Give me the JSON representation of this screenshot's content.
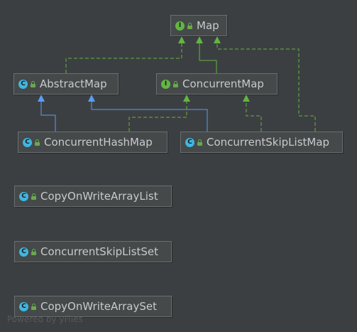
{
  "nodes": {
    "map": {
      "label": "Map",
      "kind": "interface",
      "kind_letter": "I"
    },
    "abstract_map": {
      "label": "AbstractMap",
      "kind": "class",
      "kind_letter": "C"
    },
    "concurrent_map": {
      "label": "ConcurrentMap",
      "kind": "interface",
      "kind_letter": "I"
    },
    "concurrent_hash_map": {
      "label": "ConcurrentHashMap",
      "kind": "class",
      "kind_letter": "C"
    },
    "concurrent_skip_list_map": {
      "label": "ConcurrentSkipListMap",
      "kind": "class",
      "kind_letter": "C"
    },
    "copy_on_write_array_list": {
      "label": "CopyOnWriteArrayList",
      "kind": "class",
      "kind_letter": "C"
    },
    "concurrent_skip_list_set": {
      "label": "ConcurrentSkipListSet",
      "kind": "class",
      "kind_letter": "C"
    },
    "copy_on_write_array_set": {
      "label": "CopyOnWriteArraySet",
      "kind": "class",
      "kind_letter": "C"
    }
  },
  "edges": [
    {
      "from": "abstract_map",
      "to": "map",
      "type": "implements"
    },
    {
      "from": "concurrent_map",
      "to": "map",
      "type": "extends-interface"
    },
    {
      "from": "concurrent_skip_list_map",
      "to": "map",
      "type": "implements"
    },
    {
      "from": "concurrent_hash_map",
      "to": "abstract_map",
      "type": "extends-class"
    },
    {
      "from": "concurrent_skip_list_map",
      "to": "abstract_map",
      "type": "extends-class"
    },
    {
      "from": "concurrent_hash_map",
      "to": "concurrent_map",
      "type": "implements"
    },
    {
      "from": "concurrent_skip_list_map",
      "to": "concurrent_map",
      "type": "implements"
    }
  ],
  "colors": {
    "background": "#3c3f41",
    "implements": "#62b543",
    "extends_interface": "#62b543",
    "extends_class": "#589df6",
    "interface_icon": "#62b543",
    "class_icon": "#40b6e0"
  },
  "watermark": "Powered by yFiles"
}
